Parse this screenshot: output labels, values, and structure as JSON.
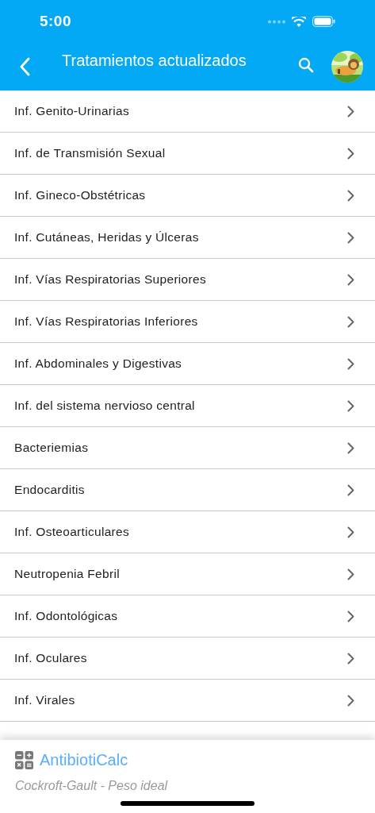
{
  "status_bar": {
    "time": "5:00"
  },
  "header": {
    "title": "Tratamientos actualizados"
  },
  "items": [
    {
      "label": "Inf. Genito-Urinarias"
    },
    {
      "label": "Inf. de Transmisión Sexual"
    },
    {
      "label": "Inf. Gineco-Obstétricas"
    },
    {
      "label": "Inf. Cutáneas, Heridas y Úlceras"
    },
    {
      "label": "Inf. Vías Respiratorias Superiores"
    },
    {
      "label": "Inf. Vías Respiratorias Inferiores"
    },
    {
      "label": "Inf. Abdominales y Digestivas"
    },
    {
      "label": "Inf. del sistema nervioso central"
    },
    {
      "label": "Bacteriemias"
    },
    {
      "label": "Endocarditis"
    },
    {
      "label": "Inf. Osteoarticulares"
    },
    {
      "label": "Neutropenia Febril"
    },
    {
      "label": "Inf. Odontológicas"
    },
    {
      "label": "Inf. Oculares"
    },
    {
      "label": "Inf. Virales"
    }
  ],
  "footer": {
    "title": "AntibiotiCalc",
    "subtitle": "Cockroft-Gault - Peso ideal"
  }
}
